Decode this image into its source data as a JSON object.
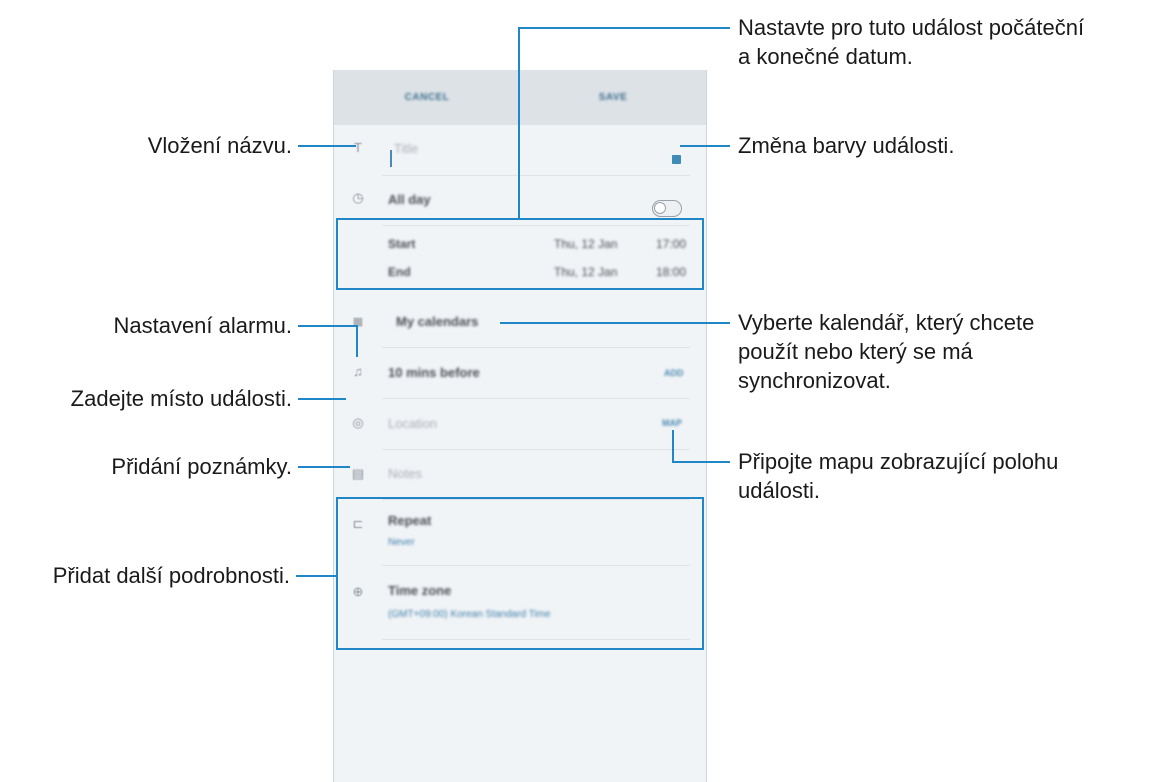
{
  "screen": {
    "cancel_label": "CANCEL",
    "save_label": "SAVE",
    "title_placeholder": "Title",
    "all_day_label": "All day",
    "start_label": "Start",
    "start_date": "Thu, 12 Jan",
    "start_time": "17:00",
    "end_label": "End",
    "end_date": "Thu, 12 Jan",
    "end_time": "18:00",
    "calendar_label": "My calendars",
    "alarm_label": "10 mins before",
    "alarm_action": "ADD",
    "location_placeholder": "Location",
    "location_action": "MAP",
    "notes_placeholder": "Notes",
    "repeat_label": "Repeat",
    "repeat_value": "Never",
    "timezone_label": "Time zone",
    "timezone_value": "(GMT+09:00) Korean Standard Time",
    "all_day_on": false
  },
  "annotations": {
    "title": "Vložení názvu.",
    "alarm": "Nastavení alarmu.",
    "location": "Zadejte místo události.",
    "notes": "Přidání poznámky.",
    "details": "Přidat další podrobnosti.",
    "dates_line1": "Nastavte pro tuto událost počáteční",
    "dates_line2": "a konečné datum.",
    "color": "Změna barvy události.",
    "calendar_line1": "Vyberte kalendář, který chcete",
    "calendar_line2": "použít nebo který se má",
    "calendar_line3": "synchronizovat.",
    "map_line1": "Připojte mapu zobrazující polohu",
    "map_line2": "události."
  },
  "colors": {
    "accent": "#1f87c8",
    "event_color": "#3f8bb8"
  },
  "icons": [
    "title-icon",
    "clock-icon",
    "calendar-icon",
    "bell-icon",
    "location-pin-icon",
    "notes-icon",
    "repeat-icon",
    "globe-icon"
  ]
}
